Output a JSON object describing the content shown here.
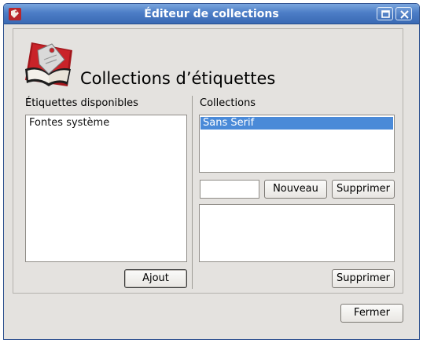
{
  "window": {
    "title": "Éditeur de collections"
  },
  "header": {
    "title": "Collections d’étiquettes",
    "icon": "tag-book-icon"
  },
  "available": {
    "label": "Étiquettes disponibles",
    "items": [
      "Fontes système"
    ],
    "add_button": "Ajout"
  },
  "collections": {
    "label": "Collections",
    "items": [
      "Sans Serif"
    ],
    "selected_index": 0,
    "new_name_value": "",
    "new_button": "Nouveau",
    "delete_collection_button": "Supprimer",
    "members": [],
    "delete_member_button": "Supprimer"
  },
  "footer": {
    "close_button": "Fermer"
  },
  "colors": {
    "titlebar": "#4c7dc6",
    "selection": "#4a8ad8",
    "window_bg": "#e4e2df"
  }
}
